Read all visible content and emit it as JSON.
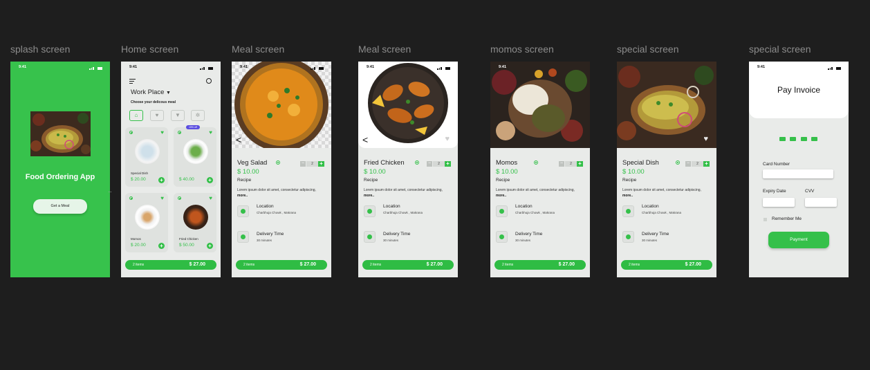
{
  "frames": [
    {
      "label": "splash screen"
    },
    {
      "label": "Home screen"
    },
    {
      "label": "Meal screen"
    },
    {
      "label": "Meal screen"
    },
    {
      "label": "momos screen"
    },
    {
      "label": "special screen"
    },
    {
      "label": "special screen"
    }
  ],
  "status_time": "9:41",
  "colors": {
    "accent": "#35c04a",
    "background": "#1e1e1e",
    "screen": "#e9ebe9"
  },
  "splash": {
    "title": "Food Ordering App",
    "button": "Get a Meal"
  },
  "home": {
    "location": "Work Place",
    "tagline": "Choose your delicous meal",
    "filters": [
      "home-icon",
      "heart-icon",
      "filter-icon",
      "dish-icon"
    ],
    "badge": "15% off",
    "cards": [
      {
        "name": "Special Dish",
        "price": "$ 20.00"
      },
      {
        "name": "",
        "price": "$ 40.00"
      },
      {
        "name": "Momos",
        "price": "$ 20.00"
      },
      {
        "name": "Fried Chicken",
        "price": "$ 50.00"
      }
    ],
    "cart_items": "2 items",
    "cart_total": "$ 27.00"
  },
  "detail_common": {
    "price": "$ 10.00",
    "recipe": "Recipe",
    "desc": "Lorem ipsum dolor sit amet, consectetur adipiscing,",
    "more": "more..",
    "location_label": "Location",
    "location_value": "Charbhuja Chowk , Makrana",
    "delivery_label": "Delivery Time",
    "delivery_value": "30 minutes",
    "qty": "2",
    "cart_items": "2 items",
    "cart_total": "$ 27.00",
    "back": "<"
  },
  "meals": [
    {
      "title": "Veg Salad"
    },
    {
      "title": "Fried Chicken"
    },
    {
      "title": "Momos"
    },
    {
      "title": "Special Dish"
    }
  ],
  "invoice": {
    "title": "Pay Invoice",
    "card_number": "Card Number",
    "expiry": "Expiry Date",
    "cvv": "CVV",
    "remember": "Remember  Me",
    "button": "Payment"
  }
}
